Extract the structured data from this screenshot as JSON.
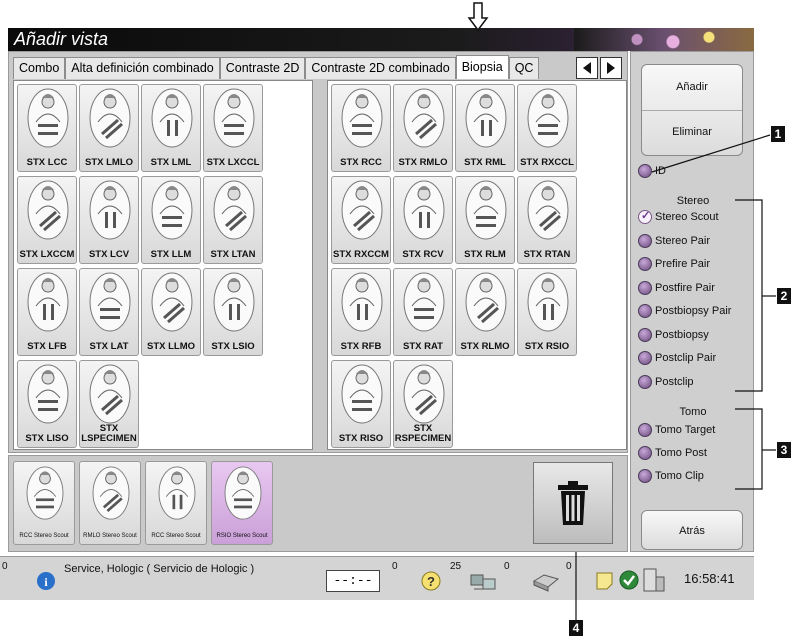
{
  "window": {
    "title": "Añadir vista"
  },
  "tabs": [
    {
      "label": "Combo"
    },
    {
      "label": "Alta definición combinado"
    },
    {
      "label": "Contraste 2D"
    },
    {
      "label": "Contraste 2D combinado"
    },
    {
      "label": "Biopsia",
      "active": true
    },
    {
      "label": "QC"
    }
  ],
  "left_views": [
    {
      "label": "STX LCC",
      "icon": "cc-compression-icon"
    },
    {
      "label": "STX LMLO",
      "icon": "mlo-compression-icon"
    },
    {
      "label": "STX LML",
      "icon": "ml-compression-icon"
    },
    {
      "label": "STX LXCCL",
      "icon": "cc-compression-icon"
    },
    {
      "label": "STX LXCCM",
      "icon": "cc-compression-icon"
    },
    {
      "label": "STX LCV",
      "icon": "cv-compression-icon"
    },
    {
      "label": "STX LLM",
      "icon": "lm-compression-icon"
    },
    {
      "label": "STX LTAN",
      "icon": "tan-compression-icon"
    },
    {
      "label": "STX LFB",
      "icon": "fb-compression-icon"
    },
    {
      "label": "STX LAT",
      "icon": "lat-compression-icon"
    },
    {
      "label": "STX LLMO",
      "icon": "lmo-compression-icon"
    },
    {
      "label": "STX LSIO",
      "icon": "sio-compression-icon"
    },
    {
      "label": "STX LISO",
      "icon": "iso-compression-icon"
    },
    {
      "label": "STX LSPECIMEN",
      "icon": "specimen-icon"
    }
  ],
  "right_views": [
    {
      "label": "STX RCC",
      "icon": "cc-compression-icon"
    },
    {
      "label": "STX RMLO",
      "icon": "mlo-compression-icon"
    },
    {
      "label": "STX RML",
      "icon": "ml-compression-icon"
    },
    {
      "label": "STX RXCCL",
      "icon": "cc-compression-icon"
    },
    {
      "label": "STX RXCCM",
      "icon": "cc-compression-icon"
    },
    {
      "label": "STX RCV",
      "icon": "cv-compression-icon"
    },
    {
      "label": "STX RLM",
      "icon": "lm-compression-icon"
    },
    {
      "label": "STX RTAN",
      "icon": "tan-compression-icon"
    },
    {
      "label": "STX RFB",
      "icon": "fb-compression-icon"
    },
    {
      "label": "STX RAT",
      "icon": "lat-compression-icon"
    },
    {
      "label": "STX RLMO",
      "icon": "lmo-compression-icon"
    },
    {
      "label": "STX RSIO",
      "icon": "sio-compression-icon"
    },
    {
      "label": "STX RISO",
      "icon": "iso-compression-icon"
    },
    {
      "label": "STX RSPECIMEN",
      "icon": "specimen-icon"
    }
  ],
  "selected_views": [
    {
      "label": "RCC Stereo Scout",
      "selected": false
    },
    {
      "label": "RMLO Stereo Scout",
      "selected": false
    },
    {
      "label": "RCC Stereo Scout",
      "selected": false
    },
    {
      "label": "RSIO Stereo Scout",
      "selected": true
    }
  ],
  "side": {
    "add_label": "Añadir",
    "remove_label": "Eliminar",
    "id_label": "ID",
    "stereo_header": "Stereo",
    "stereo_options": [
      {
        "label": "Stereo Scout",
        "checked": true
      },
      {
        "label": "Stereo Pair",
        "checked": false
      },
      {
        "label": "Prefire Pair",
        "checked": false
      },
      {
        "label": "Postfire Pair",
        "checked": false
      },
      {
        "label": "Postbiopsy Pair",
        "checked": false
      },
      {
        "label": "Postbiopsy",
        "checked": false
      },
      {
        "label": "Postclip Pair",
        "checked": false
      },
      {
        "label": "Postclip",
        "checked": false
      }
    ],
    "tomo_header": "Tomo",
    "tomo_options": [
      {
        "label": "Tomo Target"
      },
      {
        "label": "Tomo Post"
      },
      {
        "label": "Tomo Clip"
      }
    ],
    "back_label": "Atrás"
  },
  "statusbar": {
    "alarm_count": "0",
    "message": "Service, Hologic ( Servicio de Hologic )",
    "timer": "--:--",
    "help_count": "0",
    "queue_count": "25",
    "print_count": "0",
    "notes_count": "0",
    "time": "16:58:41"
  },
  "callouts": [
    "1",
    "2",
    "3",
    "4"
  ],
  "colors": {
    "selected_view": "#d8b4e4",
    "radio": "#7a5a8a"
  }
}
